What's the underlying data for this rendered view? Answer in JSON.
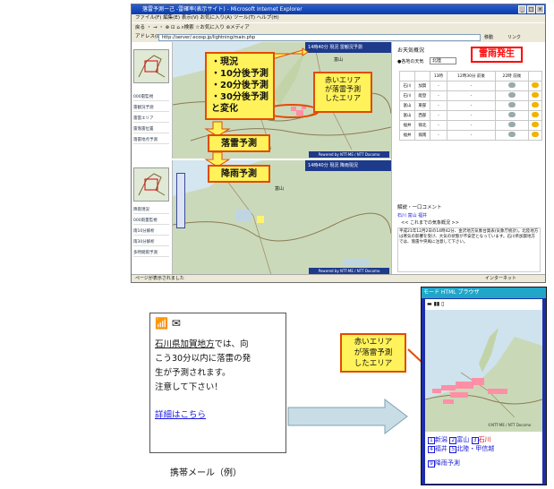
{
  "browser": {
    "title": "落雷予測ー己 -雷確率(表示サイト) - Microsoft Internet Explorer",
    "menu": "ファイル(F)  編集(E)  表示(V)  お気に入り(A)  ツール(T)  ヘルプ(H)",
    "toolbar": "戻る ・ → ・ ⊗ ⊡ ⌂   ⌕検索  ☆お気に入り  ⊛メディア",
    "address_label": "アドレス(D)",
    "address_value": "http://server/.ecosp.jp/lightning/main.php",
    "go_label": "移動",
    "links_label": "リンク",
    "status": "ページが表示されました",
    "zone": "インターネット"
  },
  "map_top": {
    "header": "14時40分 現況  雷観況予測",
    "credit": "Powered by NTT-ME / NTT Docomo",
    "sidebar": [
      "000雷監視",
      "雷観況予測",
      "雷雲エリア",
      "雷落雷位置",
      "落雷地点予測"
    ],
    "place": "富山"
  },
  "map_bottom": {
    "header": "14時40分 現況 降雨現況",
    "credit": "Powered by NTT-ME / NTT Docomo",
    "sidebar": [
      "降雨現況",
      "000雨量監視",
      "雨10分解析",
      "雨30分解析",
      "多時間雨予測"
    ],
    "place": "富山"
  },
  "callouts": {
    "stages": [
      "・現況",
      "・10分後予測",
      "・20分後予測",
      "・30分後予測",
      "と変化"
    ],
    "red_area": "赤いエリア\nが落雷予測\nしたエリア",
    "lightning_forecast": "落雷予測",
    "rain_forecast": "降雨予測",
    "thunder_alert": "雷雨発生",
    "phone_red_area": "赤いエリア\nが落雷予測\nしたエリア"
  },
  "forecast_panel": {
    "title": "お天気概況",
    "select_label": "●各地の天気",
    "select_value": "北陸",
    "columns": [
      "13時",
      "12時30分 前後",
      "22時 前後"
    ],
    "rows": [
      {
        "pref": "石川",
        "area": "加賀"
      },
      {
        "pref": "石川",
        "area": "能登"
      },
      {
        "pref": "富山",
        "area": "東部"
      },
      {
        "pref": "富山",
        "area": "西部"
      },
      {
        "pref": "福井",
        "area": "嶺北"
      },
      {
        "pref": "福井",
        "area": "嶺南"
      }
    ],
    "comment_title": "解説・一口コメント",
    "comment_tabs": "石川  富山  福井",
    "comment_nav": "<<  これまでの気象概況  >>",
    "comment_text": "平成21年12月2日の14時42分、金沢地方気象台発表(気象庁統計)。北陸地方は寒気の影響を受け、大気の状態が不安定となっています。石川県加賀地方では、落雷や突風に注意して下さい。"
  },
  "email": {
    "subject_icons": "📶 ✉",
    "line1": "石川県加賀地方",
    "line1_rest": "では、向",
    "line2": "こう30分以内に落雷の発",
    "line3": "生が予測されます。",
    "line4": "注意して下さい！",
    "link": "詳細はこちら",
    "caption": "携帯メール（例）"
  },
  "phone": {
    "header": "モード HTML ブラウザ",
    "links_row1": [
      {
        "num": "1",
        "label": "新潟"
      },
      {
        "num": "2",
        "label": "富山"
      },
      {
        "num": "3",
        "label": "石川"
      }
    ],
    "links_row2": [
      {
        "num": "4",
        "label": "福井"
      },
      {
        "num": "5",
        "label": "北陸・甲信越"
      }
    ],
    "links_row3": [
      {
        "num": "9",
        "label": "降雨予測"
      }
    ],
    "credit": "©NTT-ME / NTT Docomo"
  },
  "colors": {
    "callout_fill": "#fff25a",
    "callout_border": "#e34b00",
    "alert_red": "#ff0000",
    "link_blue": "#1a1adc",
    "map_header": "#1e3a8a",
    "phone_frame": "#1e2eaa"
  }
}
